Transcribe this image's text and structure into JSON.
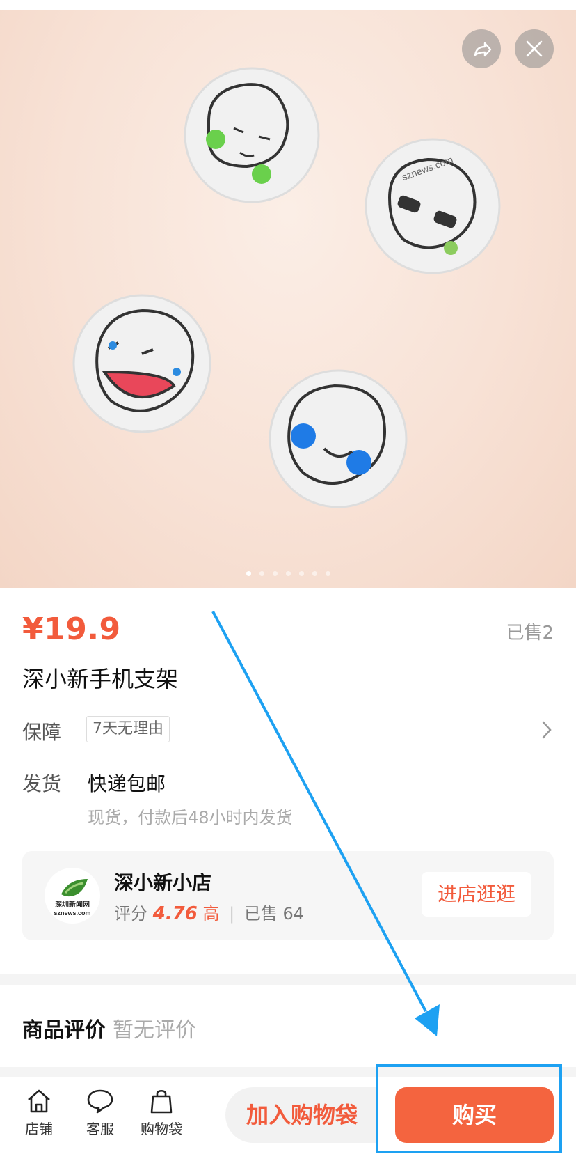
{
  "header": {
    "share_icon": "share-icon",
    "close_icon": "close-icon"
  },
  "gallery": {
    "dot_count": 7,
    "active_index": 0
  },
  "product": {
    "price": "¥19.9",
    "sold": "已售2",
    "title": "深小新手机支架",
    "guarantee_label": "保障",
    "guarantee_tag": "7天无理由",
    "shipping_label": "发货",
    "shipping_main": "快递包邮",
    "shipping_sub": "现货，付款后48小时内发货"
  },
  "shop": {
    "logo_text": "深圳新闻网 sznews.com",
    "name": "深小新小店",
    "score_label": "评分",
    "score": "4.76",
    "score_level": "高",
    "sold_label": "已售",
    "sold_count": "64",
    "enter_button": "进店逛逛"
  },
  "reviews": {
    "title": "商品评价",
    "status": "暂无评价"
  },
  "bottom_bar": {
    "nav": [
      {
        "label": "店铺",
        "icon": "home-icon"
      },
      {
        "label": "客服",
        "icon": "chat-icon"
      },
      {
        "label": "购物袋",
        "icon": "bag-icon"
      }
    ],
    "add_to_cart": "加入购物袋",
    "buy": "购买"
  },
  "colors": {
    "accent": "#f25b3c",
    "buy_button": "#f4643f",
    "annotation": "#1da1f2"
  }
}
